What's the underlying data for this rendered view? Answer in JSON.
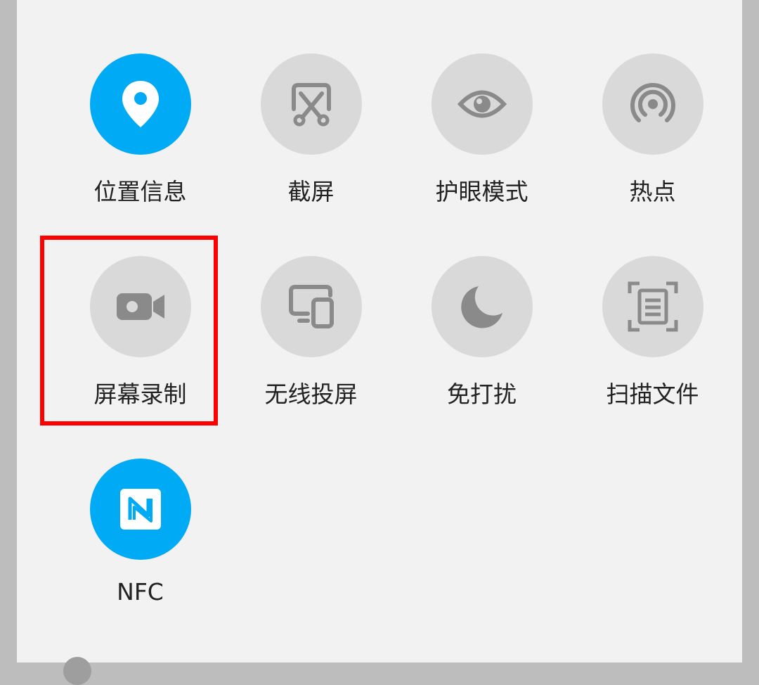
{
  "tiles": [
    {
      "label": "位置信息",
      "icon": "location-pin-icon",
      "active": true
    },
    {
      "label": "截屏",
      "icon": "screenshot-icon",
      "active": false
    },
    {
      "label": "护眼模式",
      "icon": "eye-icon",
      "active": false
    },
    {
      "label": "热点",
      "icon": "hotspot-icon",
      "active": false
    },
    {
      "label": "屏幕录制",
      "icon": "screen-record-icon",
      "active": false
    },
    {
      "label": "无线投屏",
      "icon": "wireless-projection-icon",
      "active": false
    },
    {
      "label": "免打扰",
      "icon": "moon-icon",
      "active": false
    },
    {
      "label": "扫描文件",
      "icon": "scan-document-icon",
      "active": false
    },
    {
      "label": "NFC",
      "icon": "nfc-icon",
      "active": true
    }
  ],
  "colors": {
    "active": "#00aaf5",
    "inactive": "#d9d9d9",
    "icon_inactive": "#8a8a8a",
    "highlight": "#ff0000"
  }
}
